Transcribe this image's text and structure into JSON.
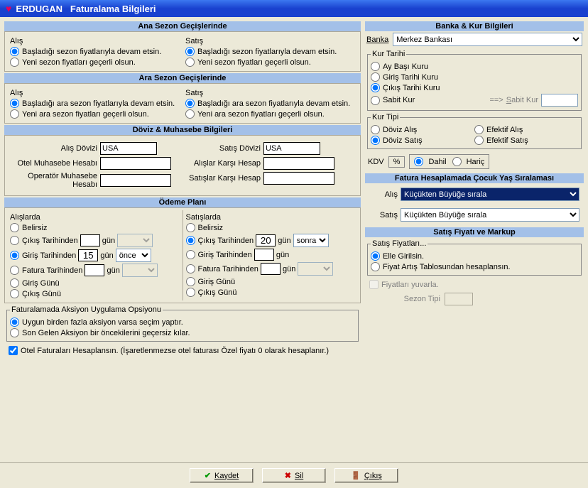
{
  "title_app": "ERDUGAN",
  "title_page": "Faturalama Bilgileri",
  "sec_ana": "Ana Sezon Geçişlerinde",
  "sec_ara": "Ara Sezon Geçişlerinde",
  "sec_doviz": "Döviz & Muhasebe Bilgileri",
  "sec_odeme": "Ödeme Planı",
  "sec_banka": "Banka & Kur Bilgileri",
  "sec_cocuk": "Fatura Hesaplamada Çocuk Yaş Sıralaması",
  "sec_satis": "Satış Fiyatı ve Markup",
  "lbl_alis": "Alış",
  "lbl_satis": "Satış",
  "r_basladigi_sezon": "Başladığı sezon fiyatlarıyla devam etsin.",
  "r_yeni_sezon": "Yeni sezon fiyatları geçerli olsun.",
  "r_basladigi_ara": "Başladığı ara sezon fiyatlarıyla devam etsin.",
  "r_yeni_ara": "Yeni ara sezon fiyatları geçerli olsun.",
  "lbl_alis_dovizi": "Alış Dövizi",
  "lbl_satis_dovizi": "Satış Dövizi",
  "val_usa": "USA",
  "lbl_otel_muh": "Otel Muhasebe Hesabı",
  "lbl_op_muh": "Operatör Muhasebe Hesabı",
  "lbl_alislar_karsi": "Alışlar Karşı Hesap",
  "lbl_satislar_karsi": "Satışlar Karşı Hesap",
  "lbl_alislarda": "Alışlarda",
  "lbl_satislarda": "Satışlarda",
  "r_belirsiz": "Belirsiz",
  "r_cikis_tarih": "Çıkış Tarihinden",
  "r_giris_tarih": "Giriş Tarihinden",
  "r_fatura_tarih": "Fatura Tarihinden",
  "r_giris_gunu": "Giriş Günü",
  "r_cikis_gunu": "Çıkış Günü",
  "lbl_gun": "gün",
  "val_15": "15",
  "val_20": "20",
  "sel_once": "önce",
  "sel_sonra": "sonra",
  "leg_aksiyon": "Faturalamada Aksiyon Uygulama Opsiyonu",
  "r_uygun": "Uygun birden fazla aksiyon varsa seçim yaptır.",
  "r_songelen": "Son Gelen Aksiyon bir öncekilerini geçersiz kılar.",
  "chk_otel_fatura": "Otel Faturaları Hesaplansın. (İşaretlenmezse otel faturası Özel fiyatı 0 olarak hesaplanır.)",
  "lbl_banka": "Banka",
  "val_banka": "Merkez Bankası",
  "leg_kurtarihi": "Kur Tarihi",
  "r_aybasi": "Ay Başı Kuru",
  "r_giris_kuru": "Giriş Tarihi Kuru",
  "r_cikis_kuru": "Çıkış Tarihi Kuru",
  "r_sabit": "Sabit Kur",
  "lbl_sabit_arrow": "==>",
  "lbl_sabit_kur": "Sabit Kur",
  "leg_kurtipi": "Kur Tipi",
  "r_doviz_alis": "Döviz Alış",
  "r_doviz_satis": "Döviz Satış",
  "r_efektif_alis": "Efektif Alış",
  "r_efektif_satis": "Efektif Satış",
  "lbl_kdv": "KDV",
  "lbl_pct": "%",
  "r_dahil": "Dahil",
  "r_haric": "Hariç",
  "lbl_cocuk_alis": "Alış",
  "lbl_cocuk_satis": "Satış",
  "val_kucukten": "Küçükten Büyüğe sırala",
  "leg_satis_fiyat": "Satış Fiyatları...",
  "r_elle": "Elle Girilsin.",
  "r_fiyat_artis": "Fiyat Artış Tablosundan hesaplansın.",
  "chk_fiyat_yuvarla": "Fiyatları yuvarla.",
  "lbl_sezon_tipi": "Sezon Tipi",
  "btn_kaydet": "Kaydet",
  "btn_sil": "Sil",
  "btn_cikis": "Çıkış"
}
